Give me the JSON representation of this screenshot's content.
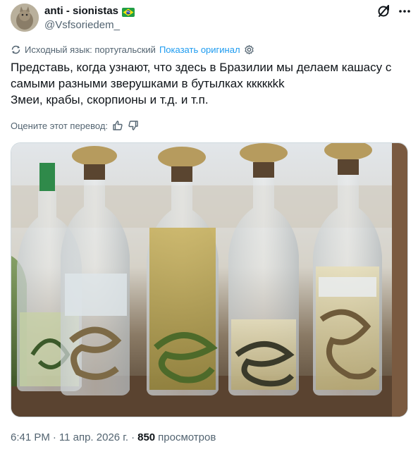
{
  "author": {
    "display_name": "anti - sionistas",
    "handle": "@Vsfsoriedem_",
    "flag": "brazil-flag-emoji"
  },
  "translation": {
    "source_label": "Исходный язык: португальский",
    "show_original": "Показать оригинал"
  },
  "tweet": {
    "line1": "Представь, когда узнают, что здесь в Бразилии мы делаем кашасу с самыми разными зверушками в бутылках кккккkk",
    "line2": "Змеи, крабы, скорпионы и т.д. и т.п."
  },
  "rate": {
    "label": "Оцените этот перевод:"
  },
  "meta": {
    "time": "6:41 PM",
    "date": "11 апр. 2026 г.",
    "views_count": "850",
    "views_label": "просмотров",
    "sep": "·"
  },
  "icons": {
    "grok": "grok-icon",
    "more": "more-icon",
    "translate": "translate-icon",
    "settings": "gear-icon",
    "like": "thumbs-up-icon",
    "dislike": "thumbs-down-icon"
  },
  "colors": {
    "link": "#1d9bf0",
    "muted": "#536471",
    "text": "#0f1419"
  }
}
